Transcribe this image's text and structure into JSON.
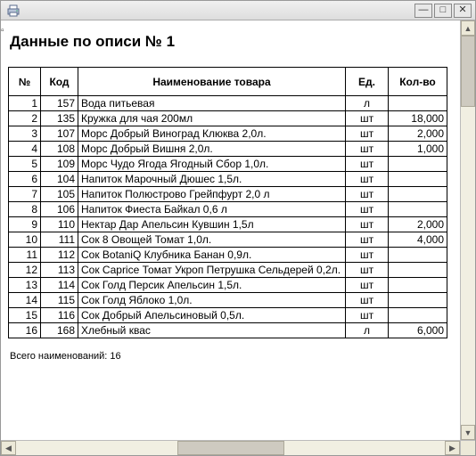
{
  "title": "Данные по описи № 1",
  "headers": {
    "num": "№",
    "code": "Код",
    "name": "Наименование товара",
    "unit": "Ед.",
    "qty": "Кол-во"
  },
  "rows": [
    {
      "num": "1",
      "code": "157",
      "name": "Вода питьевая",
      "unit": "л",
      "qty": ""
    },
    {
      "num": "2",
      "code": "135",
      "name": "Кружка для чая 200мл",
      "unit": "шт",
      "qty": "18,000"
    },
    {
      "num": "3",
      "code": "107",
      "name": "Морс Добрый Виноград Клюква 2,0л.",
      "unit": "шт",
      "qty": "2,000"
    },
    {
      "num": "4",
      "code": "108",
      "name": "Морс Добрый Вишня 2,0л.",
      "unit": "шт",
      "qty": "1,000"
    },
    {
      "num": "5",
      "code": "109",
      "name": "Морс Чудо Ягода  Ягодный Сбор 1,0л.",
      "unit": "шт",
      "qty": ""
    },
    {
      "num": "6",
      "code": "104",
      "name": "Напиток Марочный Дюшес 1,5л.",
      "unit": "шт",
      "qty": ""
    },
    {
      "num": "7",
      "code": "105",
      "name": "Напиток Полюстрово Грейпфурт 2,0 л",
      "unit": "шт",
      "qty": ""
    },
    {
      "num": "8",
      "code": "106",
      "name": "Напиток Фиеста Байкал  0,6 л",
      "unit": "шт",
      "qty": ""
    },
    {
      "num": "9",
      "code": "110",
      "name": "Нектар Дар Апельсин Кувшин 1,5л",
      "unit": "шт",
      "qty": "2,000"
    },
    {
      "num": "10",
      "code": "111",
      "name": "Сок 8 Овощей Томат 1,0л.",
      "unit": "шт",
      "qty": "4,000"
    },
    {
      "num": "11",
      "code": "112",
      "name": "Сок BotaniQ Клубника Банан 0,9л.",
      "unit": "шт",
      "qty": ""
    },
    {
      "num": "12",
      "code": "113",
      "name": "Сок Caprice Томат Укроп Петрушка Сельдерей 0,2л.",
      "unit": "шт",
      "qty": ""
    },
    {
      "num": "13",
      "code": "114",
      "name": "Сок Голд Персик Апельсин 1,5л.",
      "unit": "шт",
      "qty": ""
    },
    {
      "num": "14",
      "code": "115",
      "name": "Сок Голд Яблоко 1,0л.",
      "unit": "шт",
      "qty": ""
    },
    {
      "num": "15",
      "code": "116",
      "name": "Сок Добрый Апельсиновый 0,5л.",
      "unit": "шт",
      "qty": ""
    },
    {
      "num": "16",
      "code": "168",
      "name": "Хлебный квас",
      "unit": "л",
      "qty": "6,000"
    }
  ],
  "footer": "Всего наименований: 16",
  "window_controls": {
    "min": "—",
    "max": "□",
    "close": "✕"
  },
  "scroll_arrows": {
    "up": "▲",
    "down": "▼",
    "left": "◀",
    "right": "▶"
  }
}
